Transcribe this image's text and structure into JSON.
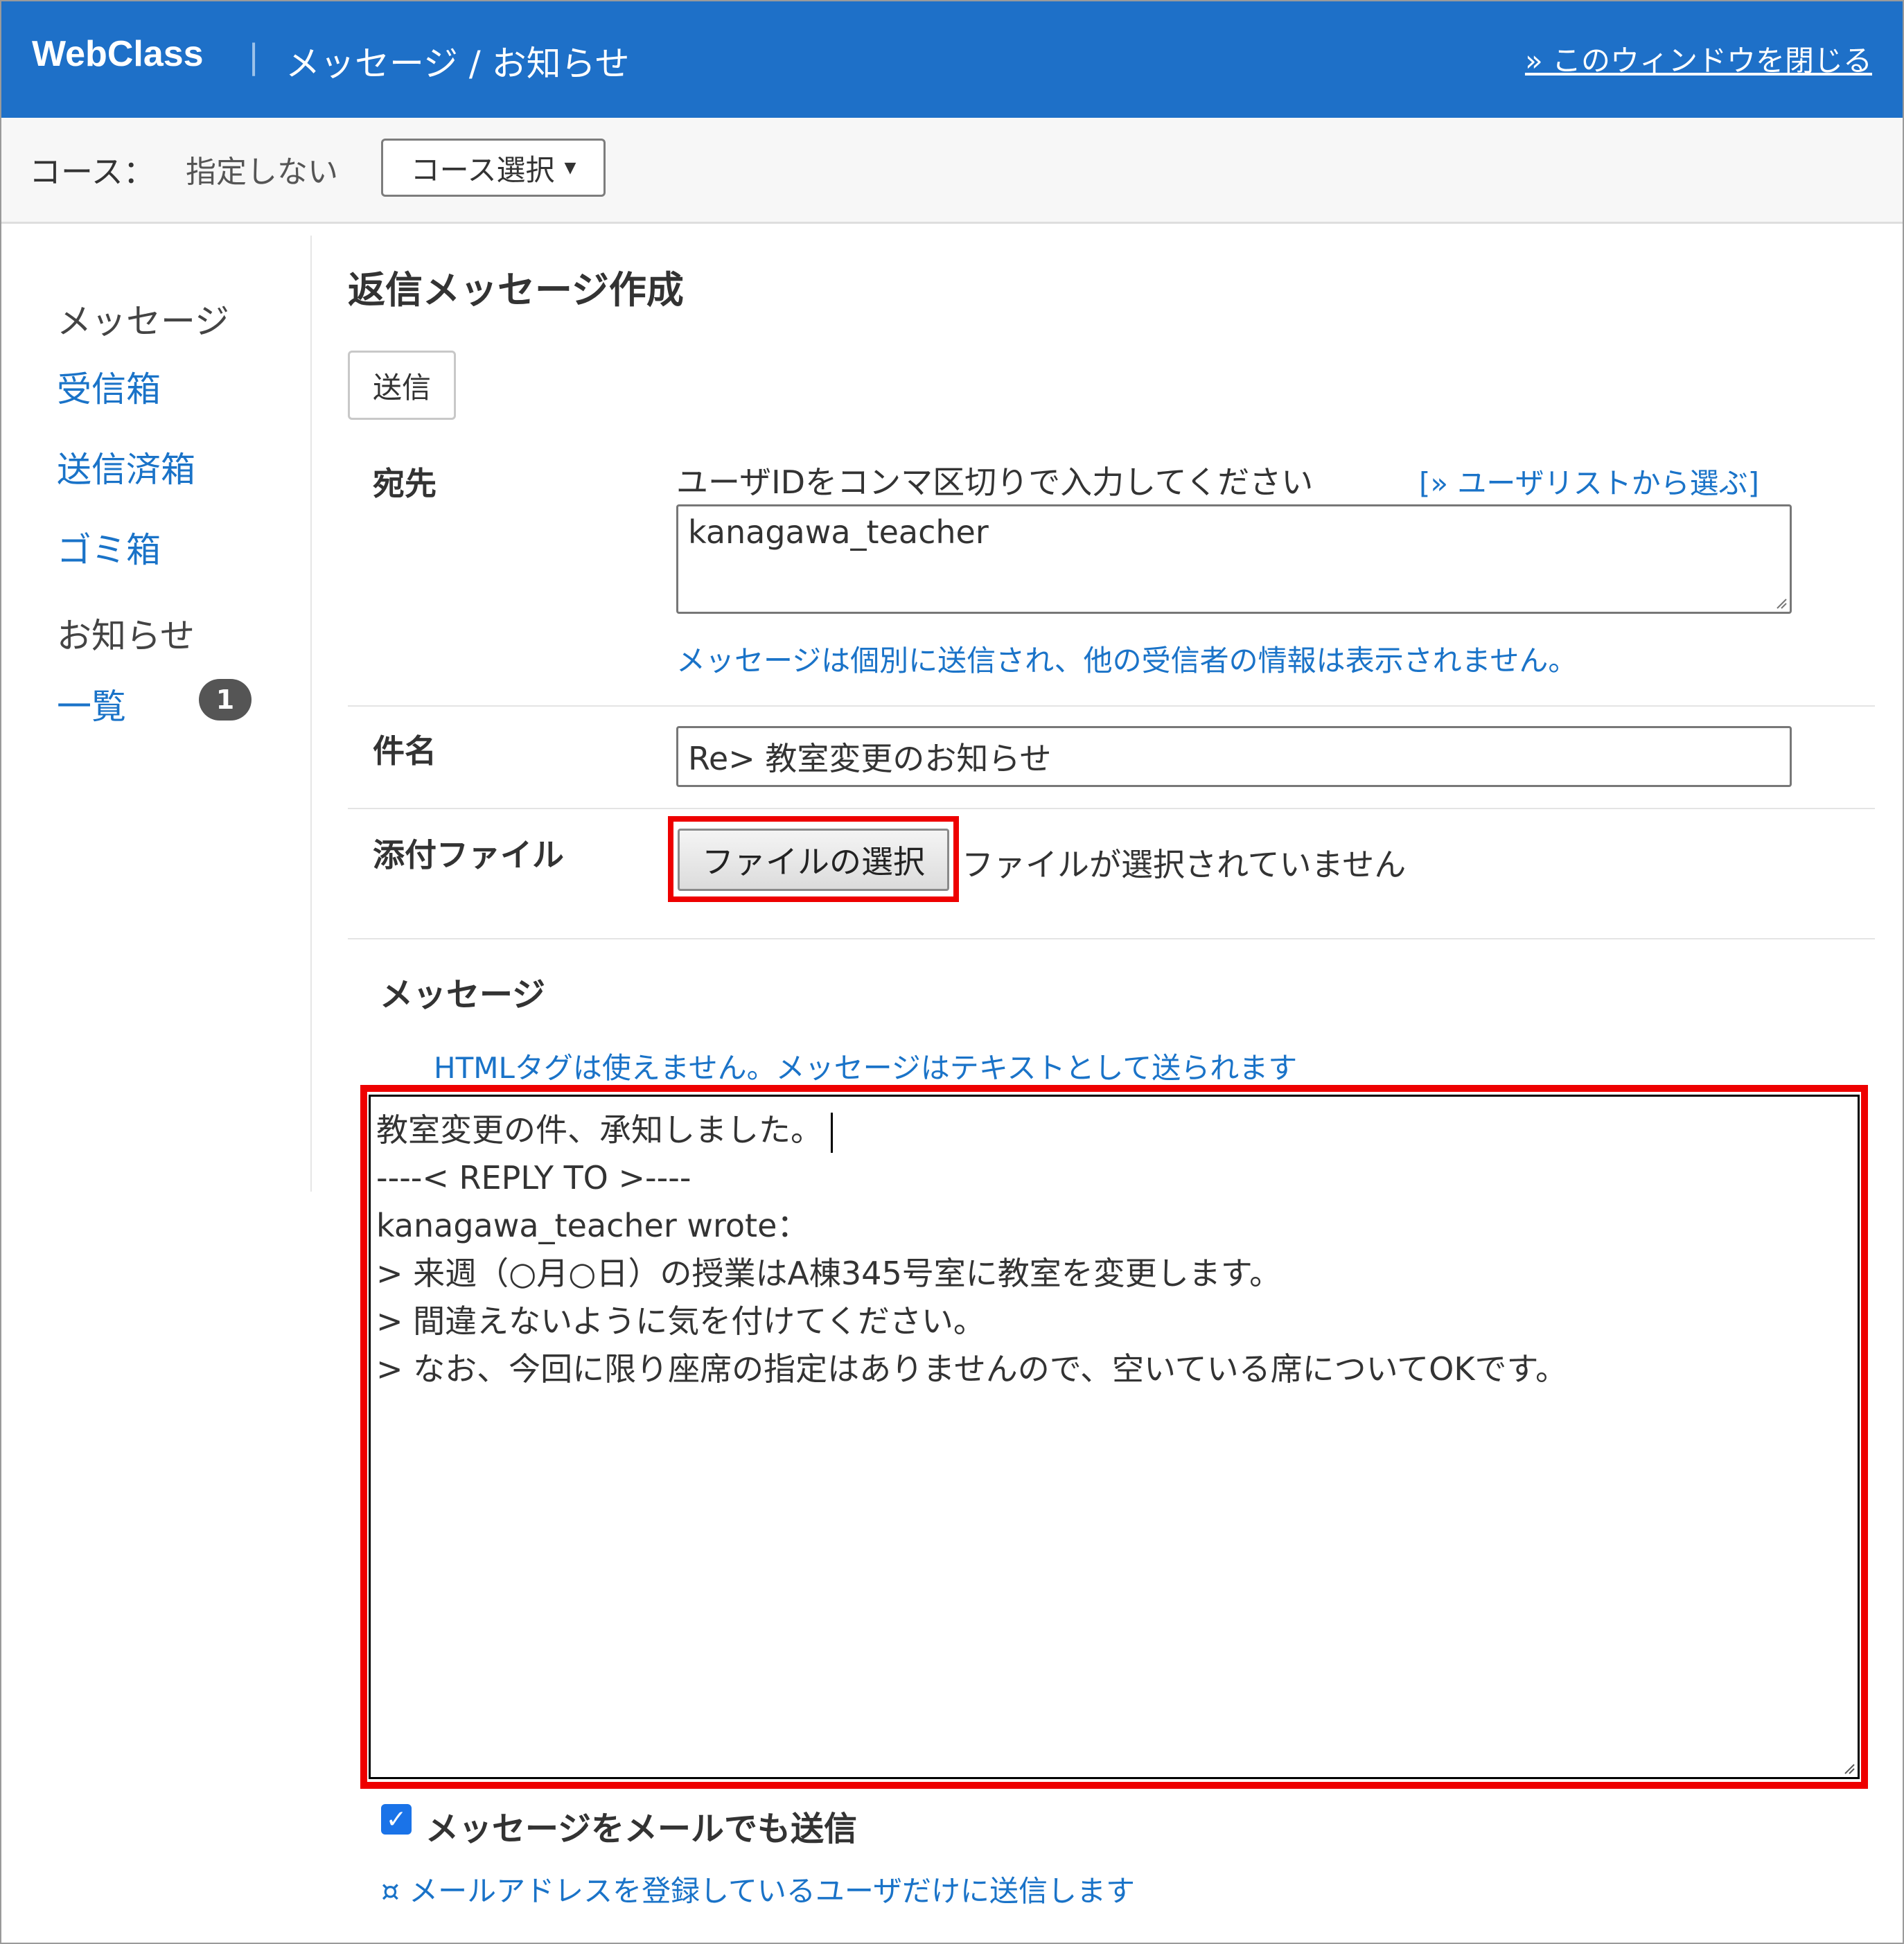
{
  "header": {
    "brand": "WebClass",
    "separator": "|",
    "title": "メッセージ / お知らせ",
    "close_link": "» このウィンドウを閉じる"
  },
  "course": {
    "label": "コース：",
    "value": "指定しない",
    "select_button": "コース選択"
  },
  "sidebar": {
    "message_heading": "メッセージ",
    "inbox": "受信箱",
    "sent": "送信済箱",
    "trash": "ゴミ箱",
    "notice_heading": "お知らせ",
    "list": "一覧",
    "list_badge": "1"
  },
  "compose": {
    "title": "返信メッセージ作成",
    "send_button": "送信",
    "to_label": "宛先",
    "to_hint": "ユーザIDをコンマ区切りで入力してください",
    "user_list_link": "[» ユーザリストから選ぶ]",
    "to_value": "kanagawa_teacher",
    "to_note": "メッセージは個別に送信され、他の受信者の情報は表示されません。",
    "subject_label": "件名",
    "subject_value": "Re> 教室変更のお知らせ",
    "attach_label": "添付ファイル",
    "file_button": "ファイルの選択",
    "file_status": "ファイルが選択されていません",
    "message_label": "メッセージ",
    "message_hint": "HTMLタグは使えません。メッセージはテキストとして送られます",
    "message_first_line": "教室変更の件、承知しました。",
    "message_rest": "\n----< REPLY TO >----\nkanagawa_teacher wrote：\n> 来週（○月○日）の授業はA棟345号室に教室を変更します。\n> 間違えないように気を付けてください。\n> なお、今回に限り座席の指定はありませんので、空いている席についてOKです。",
    "email_checkbox_label": "メッセージをメールでも送信",
    "email_checked": true,
    "email_note": "¤ メールアドレスを登録しているユーザだけに送信します"
  },
  "colors": {
    "header_bg": "#1e70c8",
    "link": "#1a73c8",
    "highlight": "#ee0000"
  }
}
